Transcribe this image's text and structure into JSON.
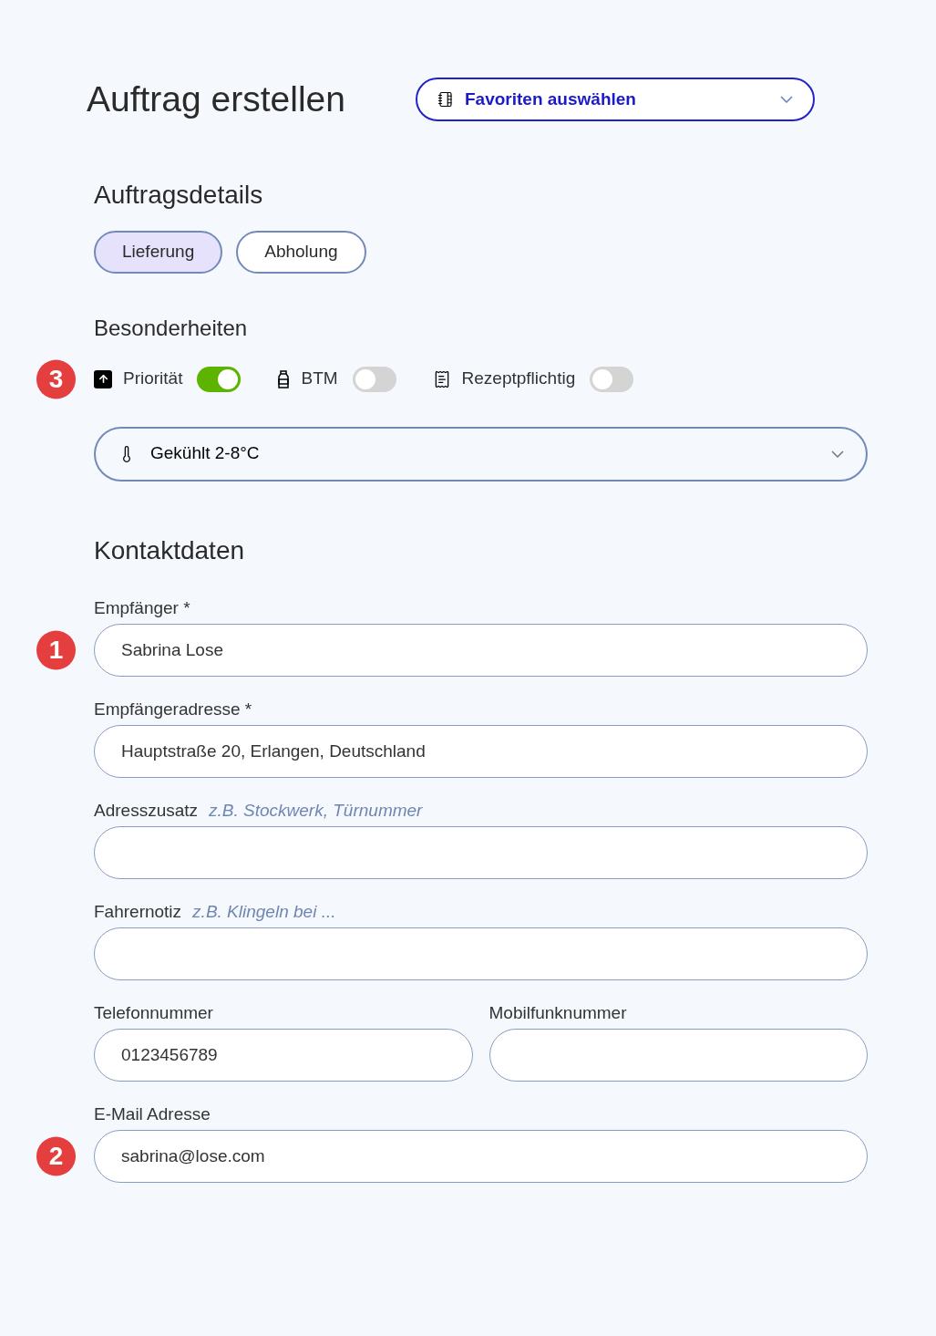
{
  "title": "Auftrag erstellen",
  "favorites": {
    "placeholder": "Favoriten auswählen"
  },
  "order_details": {
    "heading": "Auftragsdetails",
    "tabs": [
      {
        "label": "Lieferung",
        "selected": true
      },
      {
        "label": "Abholung",
        "selected": false
      }
    ]
  },
  "specials": {
    "heading": "Besonderheiten",
    "marker": "3",
    "toggles": [
      {
        "label": "Priorität",
        "on": true
      },
      {
        "label": "BTM",
        "on": false
      },
      {
        "label": "Rezeptpflichtig",
        "on": false
      }
    ],
    "temperature": {
      "value": "Gekühlt 2-8°C"
    }
  },
  "contact": {
    "heading": "Kontaktdaten",
    "rows": [
      [
        {
          "label": "Empfänger *",
          "value": "Sabrina Lose",
          "marker": "1"
        }
      ],
      [
        {
          "label": "Empfängeradresse *",
          "value": "Hauptstraße 20, Erlangen, Deutschland"
        }
      ],
      [
        {
          "label": "Adresszusatz",
          "hint": "z.B. Stockwerk, Türnummer"
        }
      ],
      [
        {
          "label": "Fahrernotiz",
          "hint": "z.B. Klingeln bei ..."
        }
      ],
      [
        {
          "label": "Telefonnummer",
          "value": "0123456789"
        },
        {
          "label": "Mobilfunknummer"
        }
      ],
      [
        {
          "label": "E-Mail Adresse",
          "value": "sabrina@lose.com",
          "marker": "2"
        }
      ]
    ]
  }
}
